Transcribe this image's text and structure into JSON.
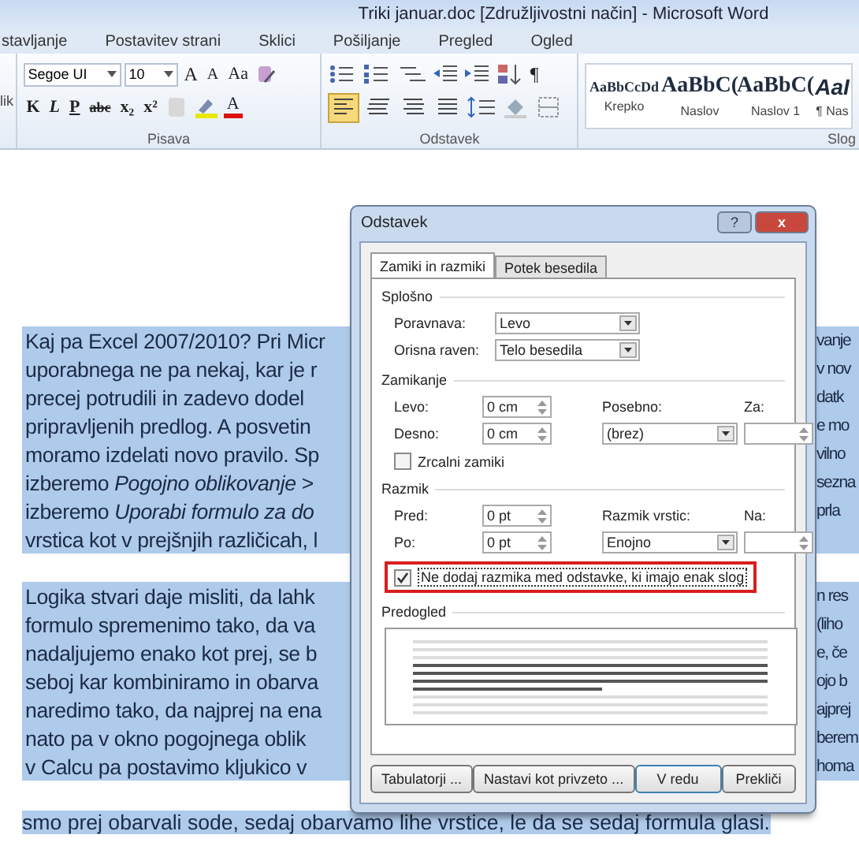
{
  "window": {
    "title": "Triki januar.doc [Združljivostni način]  -  Microsoft Word"
  },
  "ribbon_tabs": [
    {
      "label": "stavljanje",
      "selected": false
    },
    {
      "label": "Postavitev strani",
      "selected": false
    },
    {
      "label": "Sklici",
      "selected": false
    },
    {
      "label": "Pošiljanje",
      "selected": false
    },
    {
      "label": "Pregled",
      "selected": false
    },
    {
      "label": "Ogled",
      "selected": false
    }
  ],
  "clipboard": {
    "label": "lik"
  },
  "font_group": {
    "label": "Pisava",
    "font": "Segoe UI",
    "size": "10",
    "grow": "A",
    "shrink": "A",
    "case": "Aa",
    "format_buttons": [
      "K",
      "L",
      "P",
      "abc",
      "x₂",
      "x²"
    ],
    "font_color": "A"
  },
  "paragraph_group": {
    "label": "Odstavek",
    "pilcrow": "¶",
    "align_buttons": [
      {
        "selected": true
      },
      {
        "selected": false
      },
      {
        "selected": false
      },
      {
        "selected": false
      }
    ]
  },
  "styles_group": {
    "label": "Slog",
    "items": [
      {
        "sample": "AaBbCcDd",
        "name": "Krepko",
        "kind": "small"
      },
      {
        "sample": "AaBbC(",
        "name": "Naslov",
        "kind": "large"
      },
      {
        "sample": "AaBbC(",
        "name": "Naslov 1",
        "kind": "large"
      },
      {
        "sample": "AaI",
        "name": "¶ Nas",
        "kind": "italic"
      }
    ]
  },
  "document": {
    "paragraphs": [
      {
        "lines": [
          {
            "start": "Kaj pa Excel 2007/2010? Pri Micr",
            "end": "vanje"
          },
          {
            "start": "uporabnega ne pa nekaj, kar je r",
            "end": "v nov"
          },
          {
            "start": "precej potrudili in zadevo dodel",
            "end": "datk"
          },
          {
            "start": "pripravljenih predlog. A posvetin",
            "end": "e mo"
          },
          {
            "start": "moramo izdelati novo pravilo. Sp",
            "end": "vilno"
          },
          {
            "start": "izberemo *Pogojno oblikovanje* >",
            "end": "sezna"
          },
          {
            "start": "izberemo *Uporabi formulo za do*",
            "end": "prla"
          },
          {
            "start": "vrstica kot v prejšnjih različicah, l"
          }
        ]
      },
      {
        "lines": [
          {
            "start": "Logika stvari daje misliti, da lahk",
            "end": "n res"
          },
          {
            "start": "formulo spremenimo tako, da va",
            "end": "(liho"
          },
          {
            "start": "nadaljujemo enako kot prej, se b",
            "end": "e, če"
          },
          {
            "start": "seboj kar kombiniramo in obarva",
            "end": "ojo b"
          },
          {
            "start": "naredimo tako, da najprej na ena",
            "end": "ajprej"
          },
          {
            "start": "nato pa v okno pogojnega oblik",
            "end": "berem"
          },
          {
            "start": "v Calcu pa postavimo kljukico v",
            "end": "homa"
          }
        ]
      }
    ],
    "last_line": "smo prej obarvali sode, sedaj obarvamo lihe vrstice, le da se sedaj formula glasi."
  },
  "dialog": {
    "title": "Odstavek",
    "help": "?",
    "close": "x",
    "tabs": [
      {
        "label": "Zamiki in razmiki",
        "selected": true
      },
      {
        "label": "Potek besedila",
        "selected": false
      }
    ],
    "general": {
      "heading": "Splošno",
      "alignment_label": "Poravnava:",
      "alignment": "Levo",
      "outline_label": "Orisna raven:",
      "outline": "Telo besedila"
    },
    "indent": {
      "heading": "Zamikanje",
      "left_label": "Levo:",
      "left": "0 cm",
      "right_label": "Desno:",
      "right": "0 cm",
      "special_label": "Posebno:",
      "special": "(brez)",
      "by_label": "Za:",
      "mirror": {
        "label": "Zrcalni zamiki",
        "checked": false
      }
    },
    "spacing": {
      "heading": "Razmik",
      "before_label": "Pred:",
      "before": "0 pt",
      "after_label": "Po:",
      "after": "0 pt",
      "line_label": "Razmik vrstic:",
      "line": "Enojno",
      "at_label": "Na:",
      "no_space": {
        "label": "Ne dodaj razmika med odstavke, ki imajo enak slog",
        "checked": true
      }
    },
    "preview": {
      "heading": "Predogled"
    },
    "buttons": [
      "Tabulatorji ...",
      "Nastavi kot privzeto ...",
      "V redu",
      "Prekliči"
    ]
  }
}
